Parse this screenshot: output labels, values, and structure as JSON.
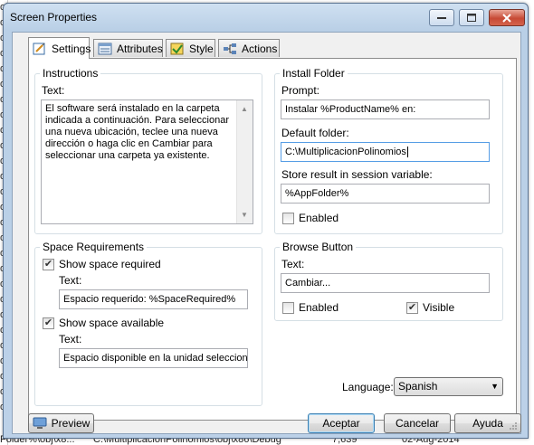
{
  "window": {
    "title": "Screen Properties",
    "controls": {
      "minimize": "—",
      "maximize": "□",
      "close": "✕"
    }
  },
  "tabs": [
    {
      "label": "Settings",
      "icon": "settings-page-icon"
    },
    {
      "label": "Attributes",
      "icon": "attributes-list-icon"
    },
    {
      "label": "Style",
      "icon": "style-palette-icon"
    },
    {
      "label": "Actions",
      "icon": "actions-flow-icon"
    }
  ],
  "instructions": {
    "legend": "Instructions",
    "text_label": "Text:",
    "text_value": "El software será instalado en la carpeta indicada a continuación. Para seleccionar una nueva ubicación, teclee una nueva dirección o haga clic en Cambiar para seleccionar una carpeta ya existente."
  },
  "install_folder": {
    "legend": "Install Folder",
    "prompt_label": "Prompt:",
    "prompt_value": "Instalar %ProductName% en:",
    "default_folder_label": "Default folder:",
    "default_folder_value": "C:\\MultiplicacionPolinomios",
    "session_var_label": "Store result in session variable:",
    "session_var_value": "%AppFolder%",
    "enabled_label": "Enabled",
    "enabled_checked": false
  },
  "space_requirements": {
    "legend": "Space Requirements",
    "show_required_label": "Show space required",
    "show_required_checked": true,
    "required_text_label": "Text:",
    "required_text_value": "Espacio requerido: %SpaceRequired%",
    "show_available_label": "Show space available",
    "show_available_checked": true,
    "available_text_label": "Text:",
    "available_text_value": "Espacio disponible en la unidad seleccionada"
  },
  "browse_button": {
    "legend": "Browse Button",
    "text_label": "Text:",
    "text_value": "Cambiar...",
    "enabled_label": "Enabled",
    "enabled_checked": false,
    "visible_label": "Visible",
    "visible_checked": true
  },
  "language": {
    "label": "Language:",
    "value": "Spanish"
  },
  "footer": {
    "preview_label": "Preview",
    "accept_label": "Aceptar",
    "cancel_label": "Cancelar",
    "help_label": "Ayuda"
  },
  "background": {
    "left_items": [
      "ol",
      "ol",
      "ol",
      "ol",
      "ol",
      "ol",
      "ol",
      "ol",
      "ol",
      "ol",
      "ol",
      "ol",
      "ol",
      "ol",
      "ol",
      "ol",
      "ol",
      "ol",
      "ol",
      "ol",
      "ol",
      "ol",
      "ol",
      "ol",
      "ol",
      "ol",
      "ol"
    ],
    "bottom_row": [
      "Folder%\\obj\\x8...",
      "C:\\MultiplicacionPolinomios\\obj\\x86\\Debug",
      "7,639",
      "02-Aug-2014"
    ]
  },
  "colors": {
    "accent": "#569de5",
    "window_frame": "#b9cfe6",
    "close_button": "#c74a35"
  }
}
